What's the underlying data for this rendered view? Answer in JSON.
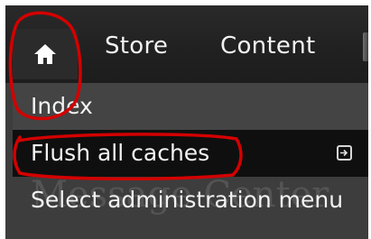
{
  "toolbar": {
    "home_icon": "home-icon",
    "items": [
      {
        "label": "Store"
      },
      {
        "label": "Content"
      }
    ]
  },
  "menu": {
    "items": [
      {
        "label": "Index"
      },
      {
        "label": "Flush all caches",
        "icon": "submenu-arrow-icon"
      },
      {
        "label": "Select administration menu"
      }
    ],
    "background_text": "Message Center"
  },
  "annotation": {
    "color": "#d40000"
  }
}
